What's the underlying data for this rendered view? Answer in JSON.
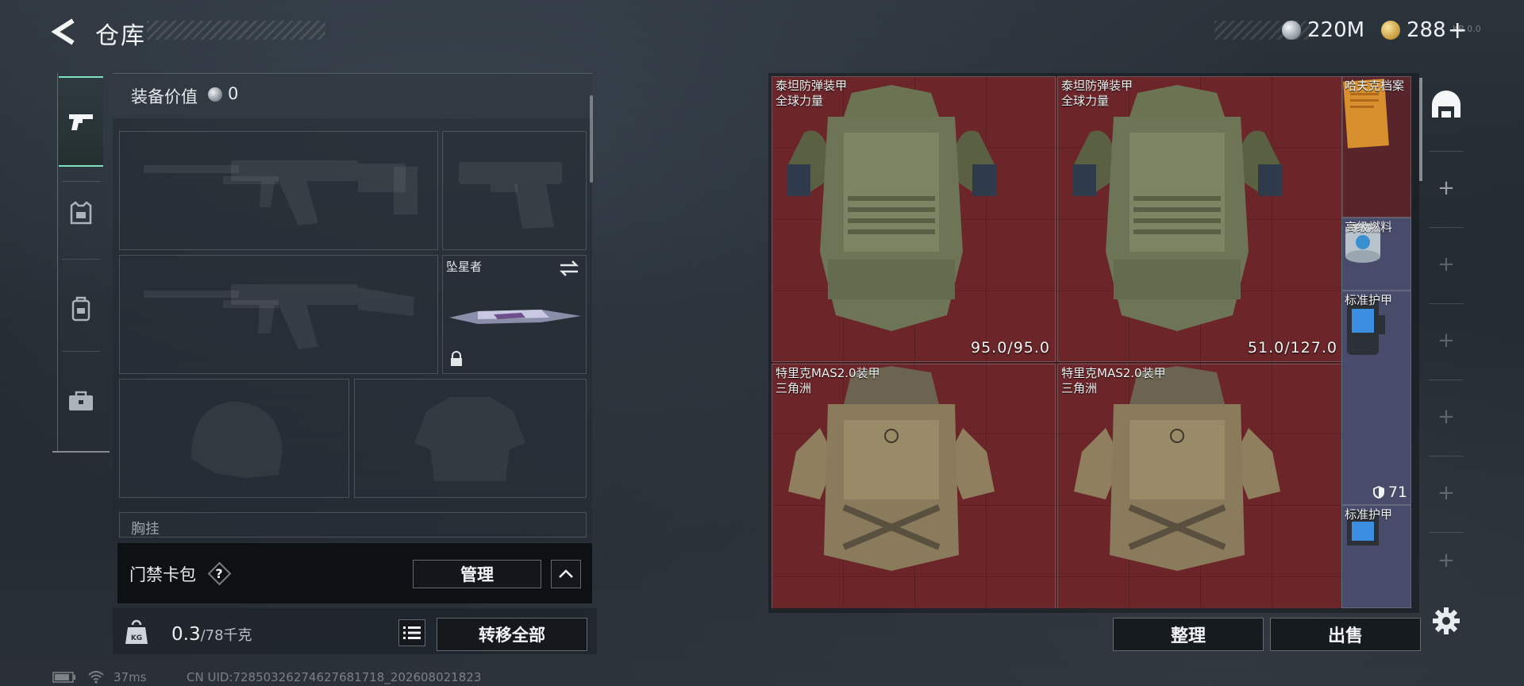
{
  "header": {
    "title": "仓库",
    "currency": [
      {
        "icon": "silver-coin-icon",
        "value": "220M"
      },
      {
        "icon": "gold-coin-icon",
        "value": "288",
        "suffix": "+"
      }
    ],
    "corner_text": "KB 0.0"
  },
  "tabs": [
    {
      "name": "weapons",
      "icon": "pistol-icon",
      "active": true
    },
    {
      "name": "armor",
      "icon": "armor-rig-icon",
      "active": false
    },
    {
      "name": "backpack",
      "icon": "backpack-icon",
      "active": false
    },
    {
      "name": "toolcase",
      "icon": "briefcase-icon",
      "active": false
    }
  ],
  "loadout": {
    "value_label": "装备价值",
    "value": "0",
    "melee_name": "坠星者",
    "chest_rig_label": "胸挂",
    "access_card_label": "门禁卡包",
    "help_label": "?",
    "manage_button": "管理",
    "weight_current": "0.3",
    "weight_max": "/78千克",
    "weight_icon_label": "KG",
    "transfer_all_button": "转移全部"
  },
  "stash": {
    "items": [
      {
        "name": "泰坦防弹装甲",
        "sub": "全球力量",
        "durability": "95.0/95.0"
      },
      {
        "name": "泰坦防弹装甲",
        "sub": "全球力量",
        "durability": "51.0/127.0"
      },
      {
        "name": "特里克MAS2.0装甲",
        "sub": "三角洲"
      },
      {
        "name": "特里克MAS2.0装甲",
        "sub": "三角洲"
      }
    ],
    "side_items": [
      {
        "name": "哈夫克档案"
      },
      {
        "name": "高级燃料"
      },
      {
        "name": "标准护甲",
        "count": "71"
      },
      {
        "name": "标准护甲"
      }
    ],
    "sort_button": "整理",
    "sell_button": "出售"
  },
  "status_bar": {
    "ping": "37ms",
    "uid": "CN UID:7285032627462768171​8_202608021823"
  },
  "colors": {
    "accent": "#7fe0c0",
    "stash_bg": "#5e2325",
    "panel_bg": "#222a32"
  }
}
